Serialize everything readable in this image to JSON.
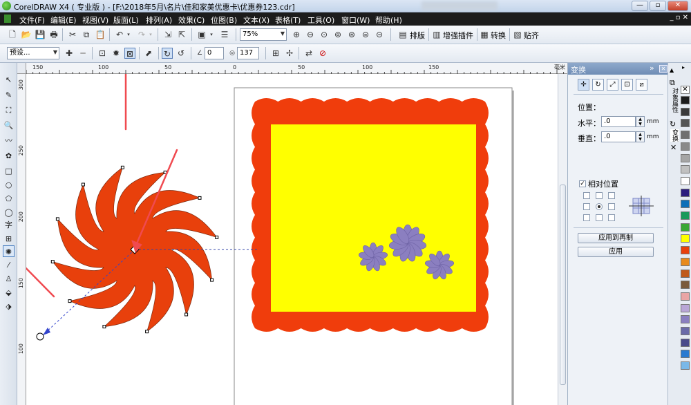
{
  "window": {
    "title": "CorelDRAW X4 ( 专业版 ) - [F:\\2018年5月\\名片\\佳和家美优惠卡\\优惠券123.cdr]",
    "minimize": "—",
    "restore": "▫",
    "close": "✕"
  },
  "menu": [
    "文件(F)",
    "编辑(E)",
    "视图(V)",
    "版面(L)",
    "排列(A)",
    "效果(C)",
    "位图(B)",
    "文本(X)",
    "表格(T)",
    "工具(O)",
    "窗口(W)",
    "帮助(H)"
  ],
  "menu_right": "_ ▫ ✕",
  "toolbar1": {
    "zoom": "75%",
    "typeset": "排版",
    "plugins": "增强插件",
    "convert": "转换",
    "paste": "贴齐"
  },
  "toolbar2": {
    "preset": "预设...",
    "angle": "0",
    "count": "137"
  },
  "ruler_h": [
    "150",
    "100",
    "50",
    "0",
    "50",
    "100",
    "150"
  ],
  "ruler_v": [
    "300",
    "250",
    "200",
    "150",
    "100"
  ],
  "docker": {
    "title": "变换",
    "position_label": "位置：",
    "h_label": "水平：",
    "h_value": ".0",
    "v_label": "垂直：",
    "v_value": ".0",
    "unit": "mm",
    "relative_label": "相对位置",
    "apply_dup": "应用到再制",
    "apply": "应用"
  },
  "side_tabs": [
    "对象属性",
    "变换"
  ],
  "colors": {
    "shape": "#e8400c",
    "frame": "#f03d0c",
    "fill": "#ffff00",
    "flower": "#8b7fc0",
    "arrow": "#f04a50"
  },
  "palette": [
    "#1c1c1c",
    "#3a3a3a",
    "#555555",
    "#707070",
    "#8a8a8a",
    "#a5a5a5",
    "#c0c0c0",
    "#ffffff",
    "#2c1d7e",
    "#0c6fb8",
    "#1a9a5a",
    "#3aa835",
    "#ffff00",
    "#e8400c",
    "#e88a1c",
    "#c05a1a",
    "#7a5a3c",
    "#e9a5a5",
    "#b9a6d6",
    "#8a7fc0",
    "#6a6aa8",
    "#4a4a8a",
    "#2a7ad0",
    "#7ab8e8"
  ]
}
